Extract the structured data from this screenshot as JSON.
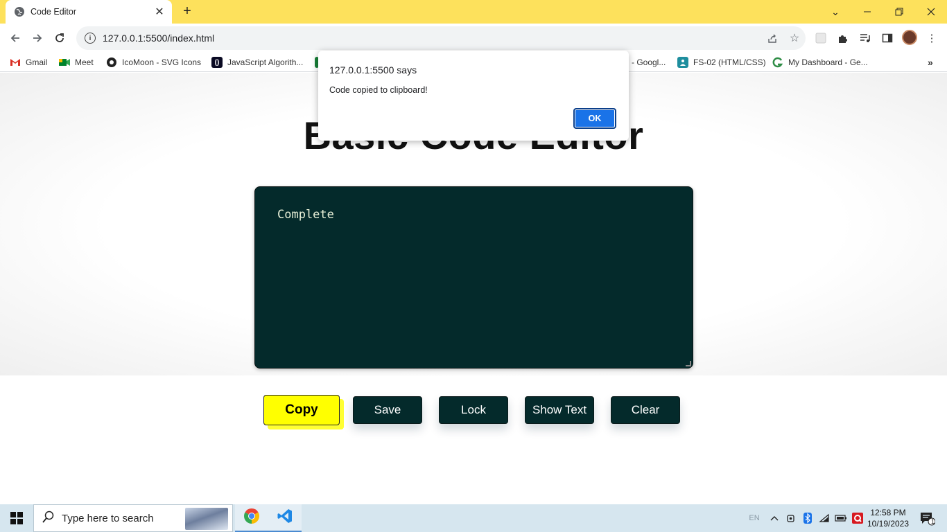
{
  "browser": {
    "tab_title": "Code Editor",
    "new_tab_symbol": "+",
    "url": "127.0.0.1:5500/index.html",
    "bookmarks": [
      {
        "label": "Gmail",
        "icon": "gmail-icon"
      },
      {
        "label": "Meet",
        "icon": "meet-icon"
      },
      {
        "label": "IcoMoon - SVG Icons",
        "icon": "icomoon-icon"
      },
      {
        "label": "JavaScript Algorith...",
        "icon": "freecodecamp-icon"
      },
      {
        "label": "- Googl...",
        "icon": "google-icon"
      },
      {
        "label": "FS-02 (HTML/CSS)",
        "icon": "classroom-icon"
      },
      {
        "label": "My Dashboard - Ge...",
        "icon": "geeks-icon"
      }
    ]
  },
  "page": {
    "title": "Basic Code Editor",
    "editor_text": "Complete",
    "buttons": {
      "copy": "Copy",
      "save": "Save",
      "lock": "Lock",
      "show_text": "Show Text",
      "clear": "Clear"
    }
  },
  "dialog": {
    "title": "127.0.0.1:5500 says",
    "message": "Code copied to clipboard!",
    "ok": "OK"
  },
  "taskbar": {
    "search_placeholder": "Type here to search",
    "language": "EN",
    "time": "12:58 PM",
    "date": "10/19/2023",
    "notification_count": "1"
  },
  "colors": {
    "tab_bar": "#fde15c",
    "editor_bg": "#042a2b",
    "copy_button": "#ffff00",
    "ok_button": "#1a73e8"
  }
}
